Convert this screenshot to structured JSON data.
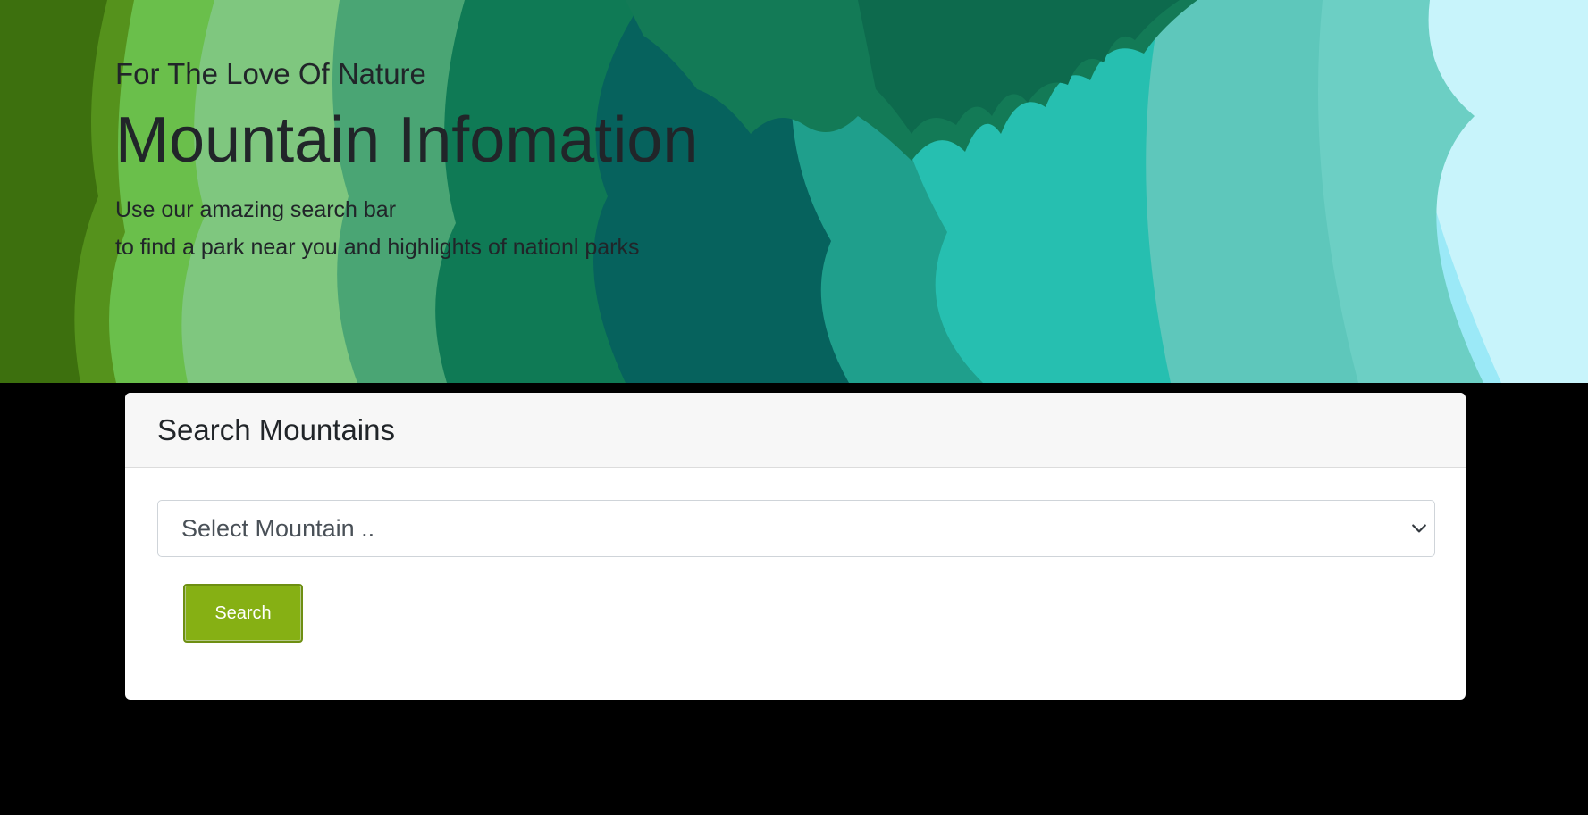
{
  "hero": {
    "kicker": "For The Love Of Nature",
    "title": "Mountain Infomation",
    "subtitle_line1": "Use our amazing search bar",
    "subtitle_line2": "to find a park near you and highlights of nationl parks"
  },
  "search_card": {
    "title": "Search Mountains",
    "select": {
      "selected_value": "Select Mountain .."
    },
    "button_label": "Search"
  },
  "icons": {
    "select_arrow": "chevron-down-icon"
  },
  "colors": {
    "page_background": "#000000",
    "button": "#86b014",
    "card_header": "#f7f7f7"
  }
}
